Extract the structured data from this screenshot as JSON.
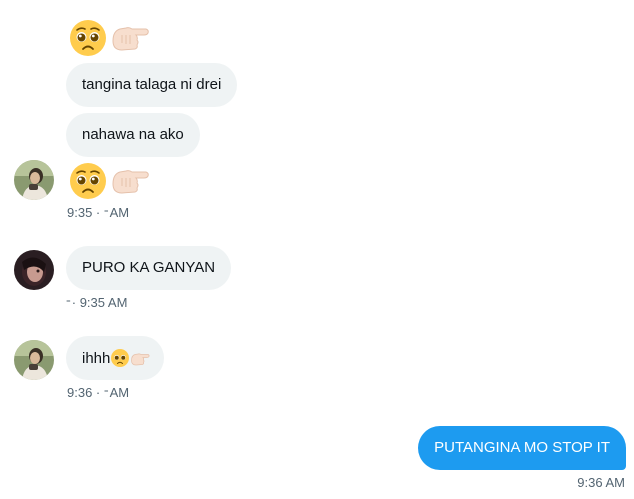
{
  "messages": {
    "m1_emoji": {
      "emoji": [
        "pleading-face",
        "pointing-hand"
      ]
    },
    "m2": {
      "text": "tangina talaga ni drei"
    },
    "m3": {
      "text": "nahawa na ako"
    },
    "m4_emoji": {
      "emoji": [
        "pleading-face",
        "pointing-hand"
      ],
      "time": "9:35 · ",
      "time_suffix": "AM"
    },
    "m5": {
      "text": "PURO KA GANYAN",
      "time": "· 9:35 AM"
    },
    "m6": {
      "text": "ihhh",
      "emoji": [
        "pleading-face",
        "pointing-hand"
      ],
      "time": "9:36 · ",
      "time_suffix": "AM"
    },
    "m7": {
      "text": "PUTANGINA MO STOP IT",
      "time": "9:36 AM"
    }
  },
  "colors": {
    "received_bubble": "#eff3f4",
    "sent_bubble": "#1d9bf0",
    "timestamp": "#536471",
    "text": "#0f1419"
  }
}
